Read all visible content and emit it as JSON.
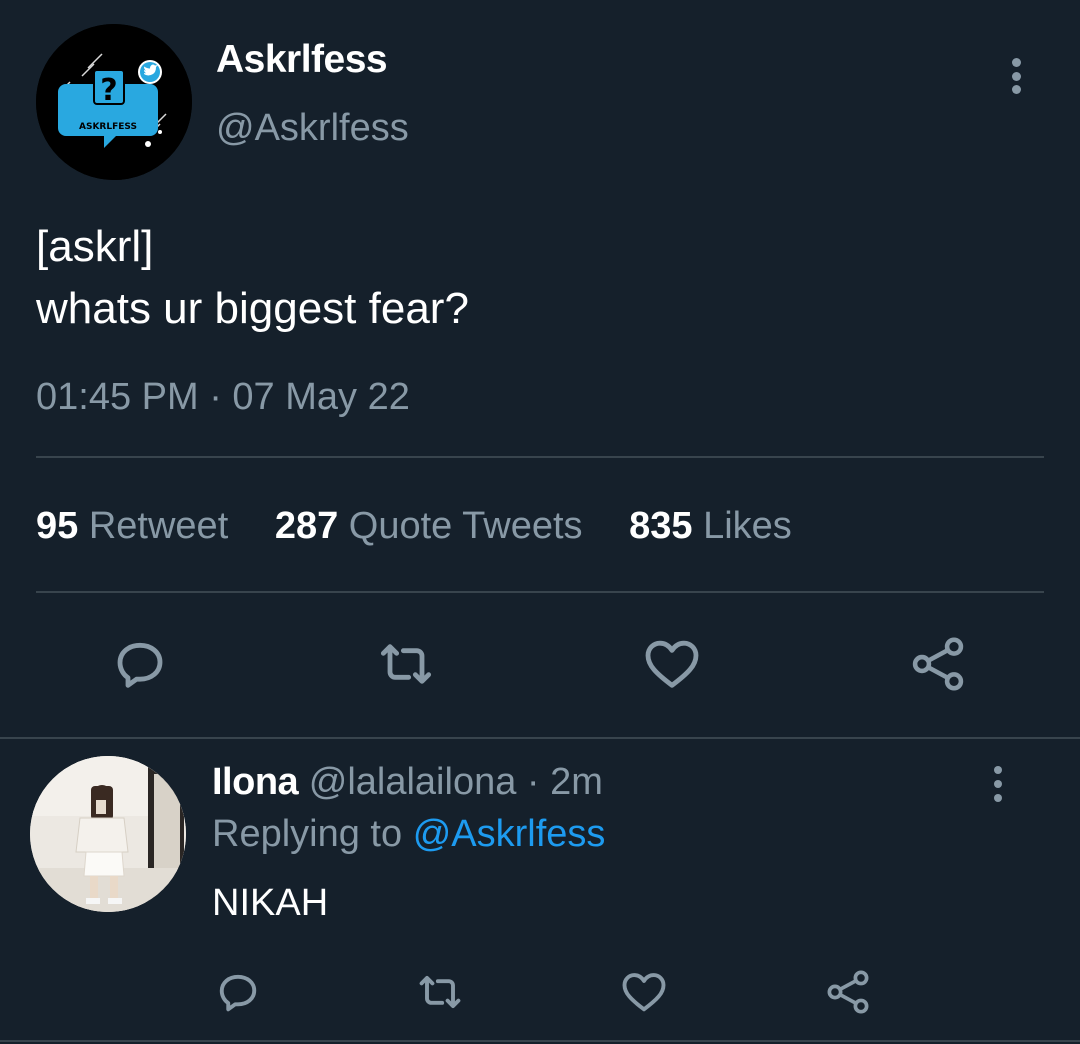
{
  "tweet": {
    "display_name": "Askrlfess",
    "handle": "@Askrlfess",
    "avatar_label": "ASKRLFESS",
    "text_line1": "[askrl]",
    "text_line2": "whats ur biggest fear?",
    "timestamp": "01:45 PM · 07 May 22",
    "stats": {
      "retweet_count": "95",
      "retweet_label": "Retweet",
      "quote_count": "287",
      "quote_label": "Quote Tweets",
      "like_count": "835",
      "like_label": "Likes"
    },
    "actions": [
      "reply-icon",
      "retweet-icon",
      "like-icon",
      "share-icon"
    ]
  },
  "reply": {
    "display_name": "Ilona",
    "handle": "@lalalailona",
    "separator": "·",
    "time": "2m",
    "replying_prefix": "Replying to",
    "replying_to": "@Askrlfess",
    "text": "NIKAH",
    "actions": [
      "reply-icon",
      "retweet-icon",
      "like-icon",
      "share-icon"
    ]
  },
  "colors": {
    "background": "#15202b",
    "secondary_text": "#8899a6",
    "divider": "#38444d",
    "accent": "#1d9bf0"
  }
}
